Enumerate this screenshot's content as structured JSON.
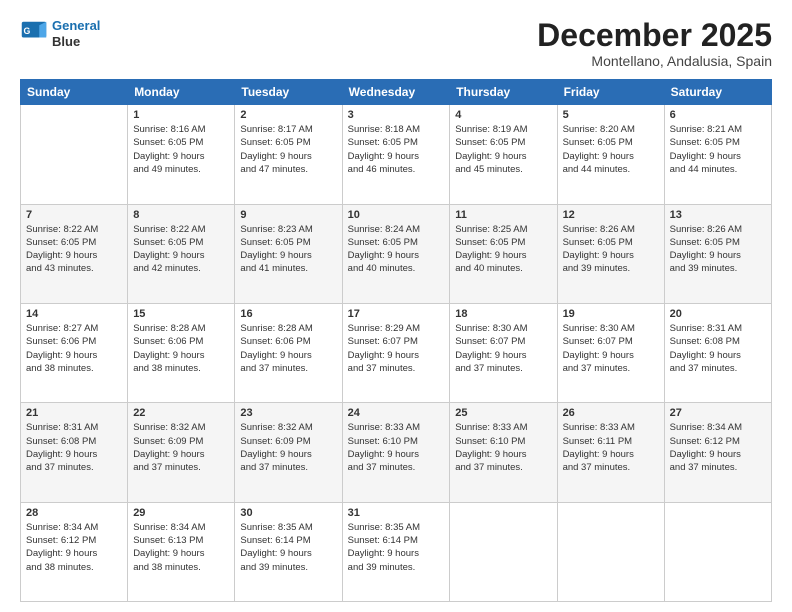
{
  "header": {
    "logo_line1": "General",
    "logo_line2": "Blue",
    "title": "December 2025",
    "location": "Montellano, Andalusia, Spain"
  },
  "weekdays": [
    "Sunday",
    "Monday",
    "Tuesday",
    "Wednesday",
    "Thursday",
    "Friday",
    "Saturday"
  ],
  "weeks": [
    [
      {
        "day": "",
        "info": ""
      },
      {
        "day": "1",
        "info": "Sunrise: 8:16 AM\nSunset: 6:05 PM\nDaylight: 9 hours\nand 49 minutes."
      },
      {
        "day": "2",
        "info": "Sunrise: 8:17 AM\nSunset: 6:05 PM\nDaylight: 9 hours\nand 47 minutes."
      },
      {
        "day": "3",
        "info": "Sunrise: 8:18 AM\nSunset: 6:05 PM\nDaylight: 9 hours\nand 46 minutes."
      },
      {
        "day": "4",
        "info": "Sunrise: 8:19 AM\nSunset: 6:05 PM\nDaylight: 9 hours\nand 45 minutes."
      },
      {
        "day": "5",
        "info": "Sunrise: 8:20 AM\nSunset: 6:05 PM\nDaylight: 9 hours\nand 44 minutes."
      },
      {
        "day": "6",
        "info": "Sunrise: 8:21 AM\nSunset: 6:05 PM\nDaylight: 9 hours\nand 44 minutes."
      }
    ],
    [
      {
        "day": "7",
        "info": "Sunrise: 8:22 AM\nSunset: 6:05 PM\nDaylight: 9 hours\nand 43 minutes."
      },
      {
        "day": "8",
        "info": "Sunrise: 8:22 AM\nSunset: 6:05 PM\nDaylight: 9 hours\nand 42 minutes."
      },
      {
        "day": "9",
        "info": "Sunrise: 8:23 AM\nSunset: 6:05 PM\nDaylight: 9 hours\nand 41 minutes."
      },
      {
        "day": "10",
        "info": "Sunrise: 8:24 AM\nSunset: 6:05 PM\nDaylight: 9 hours\nand 40 minutes."
      },
      {
        "day": "11",
        "info": "Sunrise: 8:25 AM\nSunset: 6:05 PM\nDaylight: 9 hours\nand 40 minutes."
      },
      {
        "day": "12",
        "info": "Sunrise: 8:26 AM\nSunset: 6:05 PM\nDaylight: 9 hours\nand 39 minutes."
      },
      {
        "day": "13",
        "info": "Sunrise: 8:26 AM\nSunset: 6:05 PM\nDaylight: 9 hours\nand 39 minutes."
      }
    ],
    [
      {
        "day": "14",
        "info": "Sunrise: 8:27 AM\nSunset: 6:06 PM\nDaylight: 9 hours\nand 38 minutes."
      },
      {
        "day": "15",
        "info": "Sunrise: 8:28 AM\nSunset: 6:06 PM\nDaylight: 9 hours\nand 38 minutes."
      },
      {
        "day": "16",
        "info": "Sunrise: 8:28 AM\nSunset: 6:06 PM\nDaylight: 9 hours\nand 37 minutes."
      },
      {
        "day": "17",
        "info": "Sunrise: 8:29 AM\nSunset: 6:07 PM\nDaylight: 9 hours\nand 37 minutes."
      },
      {
        "day": "18",
        "info": "Sunrise: 8:30 AM\nSunset: 6:07 PM\nDaylight: 9 hours\nand 37 minutes."
      },
      {
        "day": "19",
        "info": "Sunrise: 8:30 AM\nSunset: 6:07 PM\nDaylight: 9 hours\nand 37 minutes."
      },
      {
        "day": "20",
        "info": "Sunrise: 8:31 AM\nSunset: 6:08 PM\nDaylight: 9 hours\nand 37 minutes."
      }
    ],
    [
      {
        "day": "21",
        "info": "Sunrise: 8:31 AM\nSunset: 6:08 PM\nDaylight: 9 hours\nand 37 minutes."
      },
      {
        "day": "22",
        "info": "Sunrise: 8:32 AM\nSunset: 6:09 PM\nDaylight: 9 hours\nand 37 minutes."
      },
      {
        "day": "23",
        "info": "Sunrise: 8:32 AM\nSunset: 6:09 PM\nDaylight: 9 hours\nand 37 minutes."
      },
      {
        "day": "24",
        "info": "Sunrise: 8:33 AM\nSunset: 6:10 PM\nDaylight: 9 hours\nand 37 minutes."
      },
      {
        "day": "25",
        "info": "Sunrise: 8:33 AM\nSunset: 6:10 PM\nDaylight: 9 hours\nand 37 minutes."
      },
      {
        "day": "26",
        "info": "Sunrise: 8:33 AM\nSunset: 6:11 PM\nDaylight: 9 hours\nand 37 minutes."
      },
      {
        "day": "27",
        "info": "Sunrise: 8:34 AM\nSunset: 6:12 PM\nDaylight: 9 hours\nand 37 minutes."
      }
    ],
    [
      {
        "day": "28",
        "info": "Sunrise: 8:34 AM\nSunset: 6:12 PM\nDaylight: 9 hours\nand 38 minutes."
      },
      {
        "day": "29",
        "info": "Sunrise: 8:34 AM\nSunset: 6:13 PM\nDaylight: 9 hours\nand 38 minutes."
      },
      {
        "day": "30",
        "info": "Sunrise: 8:35 AM\nSunset: 6:14 PM\nDaylight: 9 hours\nand 39 minutes."
      },
      {
        "day": "31",
        "info": "Sunrise: 8:35 AM\nSunset: 6:14 PM\nDaylight: 9 hours\nand 39 minutes."
      },
      {
        "day": "",
        "info": ""
      },
      {
        "day": "",
        "info": ""
      },
      {
        "day": "",
        "info": ""
      }
    ]
  ]
}
